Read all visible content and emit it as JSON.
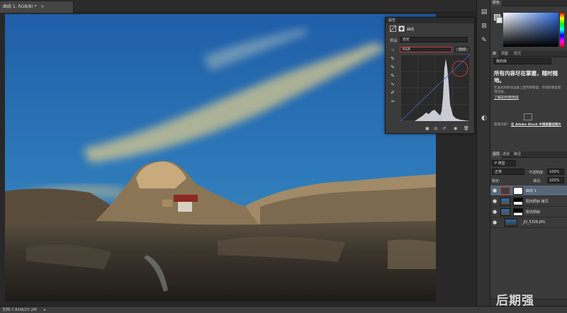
{
  "document": {
    "tab_title": "曲线 1, RGB/8) *",
    "tab_close": "×"
  },
  "statusbar": {
    "doc_info": "文档:7.81M/27.2M",
    "arrow": "▸"
  },
  "properties_panel": {
    "title": "属性",
    "adjustment_name": "曲线",
    "preset_label": "预设:",
    "preset_value": "自定",
    "channel_value": "RGB",
    "auto_button": "自动",
    "curve_points": [
      [
        0,
        0
      ],
      [
        255,
        255
      ]
    ]
  },
  "color_panel": {
    "tabs": [
      "颜色"
    ],
    "accent": "#2d6be0"
  },
  "libraries_panel": {
    "tabs": [
      "库",
      "调整",
      "样式"
    ],
    "library_select": "我的库",
    "heading": "所有内容尽在掌握，随时随地。",
    "body": "在桌式和移动设备上使用库整理、存储和重复使用资源。",
    "link": "了解如何使用库",
    "footer_prefix": "需要内容？",
    "footer_link": "在 Adobe Stock 中搜索最佳照片"
  },
  "layers_panel": {
    "tabs": [
      "图层",
      "通道",
      "路径"
    ],
    "filter": "P 类型",
    "blend_mode": "正常",
    "opacity_label": "不透明度:",
    "opacity_value": "100%",
    "lock_label": "锁定:",
    "fill_label": "填充:",
    "fill_value": "100%",
    "layers": [
      {
        "name": "曲线 1",
        "selected": true
      },
      {
        "name": "阳光照射 拷贝",
        "selected": false
      },
      {
        "name": "阳光照射",
        "selected": false
      },
      {
        "name": "_JQ_5326.JPG",
        "selected": false
      }
    ]
  },
  "watermark": "后期强",
  "icons": [
    "eye-icon",
    "curves-icon",
    "eyedropper-icon",
    "pencil-icon",
    "trash-icon"
  ]
}
